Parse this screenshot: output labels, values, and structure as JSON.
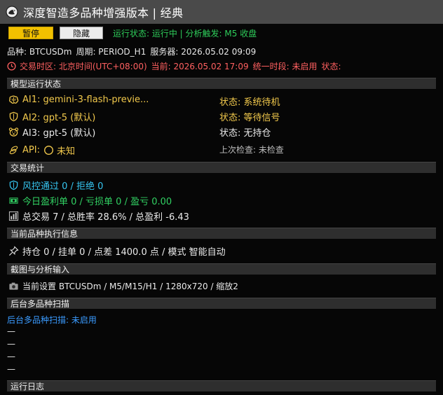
{
  "window": {
    "title": "深度智造多品种增强版本 | 经典"
  },
  "toolbar": {
    "pause_label": "暂停",
    "hide_label": "隐藏",
    "status_text": "运行状态: 运行中  |  分析触发: M5 收盘"
  },
  "info": {
    "symbol": "品种: BTCUSDm",
    "period": "周期: PERIOD_H1",
    "server": "服务器: 2026.05.02 09:09"
  },
  "timezone": {
    "zone": "交易时区: 北京时间(UTC+08:00)",
    "current": "当前: 2026.05.02 17:09",
    "session": "统一时段: 未启用",
    "state": "状态:"
  },
  "model_status": {
    "header": "模型运行状态",
    "ai1_name": "AI1: gemini-3-flash-previe...",
    "ai1_state": "状态: 系统待机",
    "ai2_name": "AI2: gpt-5 (默认)",
    "ai2_state": "状态: 等待信号",
    "ai3_name": "AI3: gpt-5 (默认)",
    "ai3_state": "状态: 无持仓",
    "api_label": "API:",
    "api_value": "未知",
    "last_check": "上次检查: 未检查"
  },
  "trade_stats": {
    "header": "交易统计",
    "risk": "风控通过 0  / 拒绝 0",
    "today": "今日盈利单 0  / 亏损单 0  / 盈亏 0.00",
    "total": "总交易 7  / 总胜率 28.6%  / 总盈利 -6.43"
  },
  "execution": {
    "header": "当前品种执行信息",
    "text": "持仓 0  / 挂单 0  / 点差 1400.0 点  / 模式 智能自动"
  },
  "screenshot": {
    "header": "截图与分析输入",
    "text": "当前设置 BTCUSDm   / M5/M15/H1   / 1280x720   / 缩放2"
  },
  "scan": {
    "header": "后台多品种扫描",
    "status": "后台多品种扫描: 未启用",
    "items": [
      "—",
      "—",
      "—",
      "—"
    ]
  },
  "log": {
    "header": "运行日志"
  },
  "colors": {
    "accent_yellow": "#f2c100",
    "status_green": "#2ecc5a",
    "alert_red": "#ff6060",
    "cyan": "#36c5f0",
    "blue": "#3a9bff"
  },
  "icons": {
    "title": "crane-logo-icon",
    "clock": "clock-icon",
    "ai1": "brain-icon",
    "ai2": "shield-icon",
    "ai3": "bear-icon",
    "api": "coins-icon",
    "api_state": "circle-icon",
    "risk": "shield-check-icon",
    "today": "money-icon",
    "total": "bar-chart-icon",
    "pin": "pin-icon",
    "camera": "camera-icon"
  }
}
